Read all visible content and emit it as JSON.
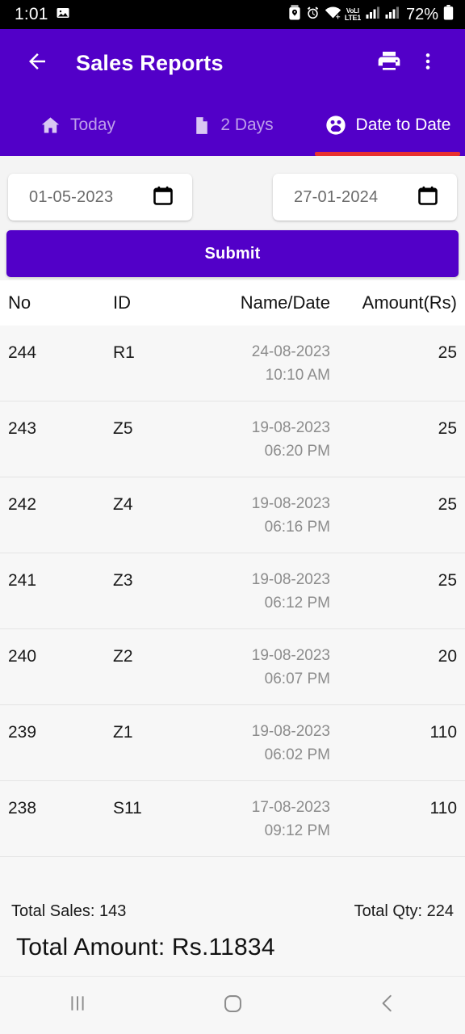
{
  "status_bar": {
    "time": "1:01",
    "battery_percent": "72%",
    "icons": [
      "image-icon",
      "battery-saver-icon",
      "alarm-icon",
      "wifi-icon",
      "volte-icon",
      "signal-icon-1",
      "signal-icon-2",
      "battery-icon"
    ],
    "volte_top": "VoLI",
    "volte_bottom": "LTE1"
  },
  "app_bar": {
    "title": "Sales Reports",
    "back_icon": "arrow-left-icon",
    "print_icon": "print-icon",
    "overflow_icon": "more-vertical-icon",
    "background": "#5200c8"
  },
  "tabs": {
    "indicator_color": "#e8312f",
    "items": [
      {
        "label": "Today",
        "icon": "home-icon",
        "active": false
      },
      {
        "label": "2 Days",
        "icon": "document-icon",
        "active": false
      },
      {
        "label": "Date to Date",
        "icon": "group-people-icon",
        "active": true
      }
    ]
  },
  "filters": {
    "from_date": "01-05-2023",
    "to_date": "27-01-2024",
    "calendar_icon": "calendar-icon",
    "submit_label": "Submit"
  },
  "table": {
    "headers": {
      "no": "No",
      "id": "ID",
      "name_date": "Name/Date",
      "amount": "Amount(Rs)"
    },
    "rows": [
      {
        "no": "244",
        "id": "R1",
        "date": "24-08-2023",
        "time": "10:10 AM",
        "amount": "25"
      },
      {
        "no": "243",
        "id": "Z5",
        "date": "19-08-2023",
        "time": "06:20 PM",
        "amount": "25"
      },
      {
        "no": "242",
        "id": "Z4",
        "date": "19-08-2023",
        "time": "06:16 PM",
        "amount": "25"
      },
      {
        "no": "241",
        "id": "Z3",
        "date": "19-08-2023",
        "time": "06:12 PM",
        "amount": "25"
      },
      {
        "no": "240",
        "id": "Z2",
        "date": "19-08-2023",
        "time": "06:07 PM",
        "amount": "20"
      },
      {
        "no": "239",
        "id": "Z1",
        "date": "19-08-2023",
        "time": "06:02 PM",
        "amount": "110"
      },
      {
        "no": "238",
        "id": "S11",
        "date": "17-08-2023",
        "time": "09:12 PM",
        "amount": "110"
      }
    ]
  },
  "totals": {
    "total_sales": "Total Sales: 143",
    "total_qty": "Total Qty: 224",
    "total_amount": "Total Amount: Rs.11834"
  },
  "nav_bar": {
    "recents_icon": "recents-icon",
    "home_icon": "home-circle-icon",
    "back_icon": "back-chevron-icon"
  }
}
